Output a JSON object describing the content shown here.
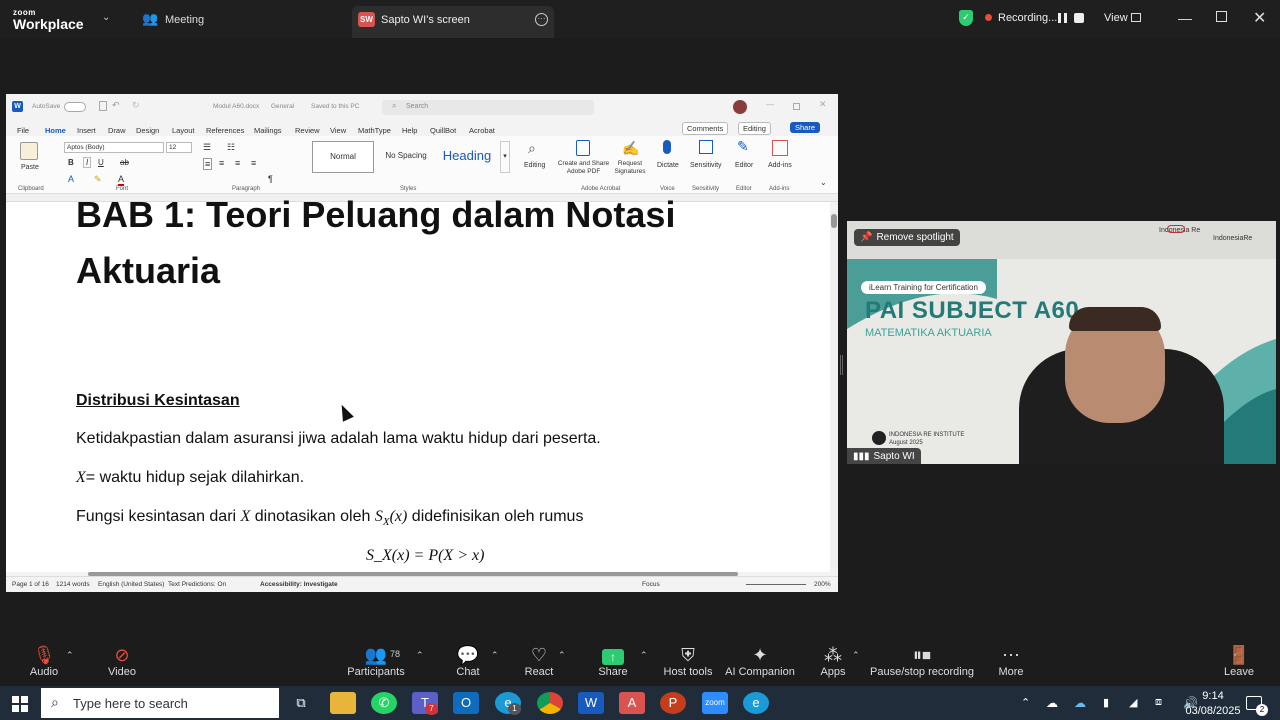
{
  "zoom": {
    "logo_line1": "zoom",
    "logo_line2": "Workplace",
    "meeting_label": "Meeting",
    "share_tab": {
      "initials": "SW",
      "label": "Sapto WI's screen"
    },
    "recording_label": "Recording...",
    "view_label": "View"
  },
  "word": {
    "autosave": "AutoSave",
    "filename": "Modul A60.docx",
    "sensitivity_label": "General",
    "saved_status": "Saved to this PC",
    "search_placeholder": "Search",
    "tabs": [
      "File",
      "Home",
      "Insert",
      "Draw",
      "Design",
      "Layout",
      "References",
      "Mailings",
      "Review",
      "View",
      "MathType",
      "Help",
      "QuillBot",
      "Acrobat"
    ],
    "active_tab": "Home",
    "comments_label": "Comments",
    "editing_label": "Editing",
    "share_label": "Share",
    "font_name": "Aptos (Body)",
    "font_size": "12",
    "paste_label": "Paste",
    "styles": [
      "Normal",
      "No Spacing",
      "Heading"
    ],
    "ribbon_groups": [
      "Clipboard",
      "Font",
      "Paragraph",
      "Styles",
      "Adobe Acrobat",
      "Voice",
      "Sensitivity",
      "Editor",
      "Add-ins"
    ],
    "ribbon_buttons": {
      "editing": "Editing",
      "create_share": "Create and Share Adobe PDF",
      "request_sig": "Request Signatures",
      "dictate": "Dictate",
      "sensitivity": "Sensitivity",
      "editor": "Editor",
      "addins": "Add-ins"
    },
    "doc": {
      "heading_line1": "BAB 1: Teori Peluang dalam Notasi",
      "heading_line2": "Aktuaria",
      "subheading": "Distribusi Kesintasan",
      "p1": "Ketidakpastian dalam asuransi jiwa adalah lama waktu hidup dari peserta.",
      "p2_var": "X",
      "p2": "= waktu hidup sejak dilahirkan.",
      "p3_a": "Fungsi kesintasan dari ",
      "p3_var": "X",
      "p3_b": " dinotasikan oleh ",
      "p3_func": "S",
      "p3_sub": "X",
      "p3_arg": "(x)",
      "p3_c": " didefinisikan oleh rumus",
      "formula": "S_X(x) = P(X > x)"
    },
    "status": {
      "page": "Page 1 of 16",
      "words": "1214 words",
      "lang": "English (United States)",
      "predictions": "Text Predictions: On",
      "accessibility": "Accessibility: Investigate",
      "focus": "Focus",
      "zoom": "200%"
    }
  },
  "video": {
    "remove_spotlight": "Remove spotlight",
    "brand_left": "Indonesia Re",
    "brand_right": "IndonesiaRe",
    "banner_sub": "iLearn Training for Certification",
    "banner_title": "PAI SUBJECT A60",
    "banner_subtitle": "MATEMATIKA AKTUARIA",
    "institute": "INDONESIA RE INSTITUTE",
    "institute_date": "August 2025",
    "participant_name": "Sapto WI"
  },
  "toolbar": {
    "audio": "Audio",
    "video": "Video",
    "participants": "Participants",
    "participants_count": "78",
    "chat": "Chat",
    "react": "React",
    "share": "Share",
    "host_tools": "Host tools",
    "ai_companion": "AI Companion",
    "apps": "Apps",
    "pause_recording": "Pause/stop recording",
    "more": "More",
    "leave": "Leave"
  },
  "taskbar": {
    "search_placeholder": "Type here to search",
    "time": "9:14",
    "date": "03/08/2025",
    "notif_count": "2",
    "teams_badge": "7",
    "edge_badge": "1"
  }
}
